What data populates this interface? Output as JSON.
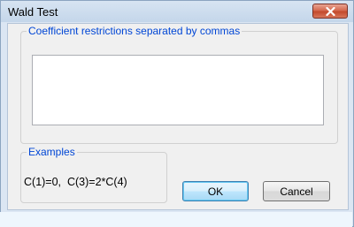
{
  "window": {
    "title": "Wald Test",
    "close_icon": "close-icon"
  },
  "coefficient_group": {
    "legend": "Coefficient restrictions separated by commas",
    "input_value": ""
  },
  "examples_group": {
    "legend": "Examples",
    "text": "C(1)=0,  C(3)=2*C(4)"
  },
  "buttons": {
    "ok_label": "OK",
    "cancel_label": "Cancel"
  },
  "colors": {
    "legend_text": "#0046d5",
    "close_button": "#c34a2c",
    "frame": "#dbe6f3"
  }
}
